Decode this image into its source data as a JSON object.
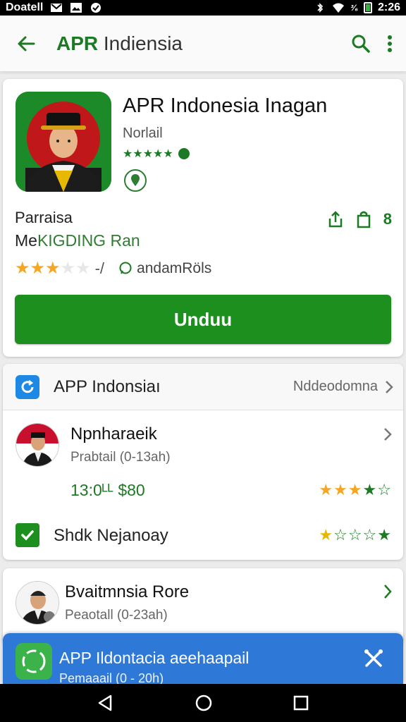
{
  "statusbar": {
    "carrier": "Doatell",
    "network": "³⁄₆",
    "time": "2:26"
  },
  "appbar": {
    "title_brand": "APR",
    "title_rest": "Indiensia"
  },
  "app": {
    "name": "APR Indonesia Inagan",
    "developer": "Norlail",
    "meta_line1": "Parraisa",
    "meta_line2_a": "Me",
    "meta_line2_b": "KIGDING Ran",
    "count_badge": "8",
    "rating_dash": "-/",
    "review_label": "andamRöls",
    "rating_stars": 3,
    "install_label": "Unduu"
  },
  "section": {
    "title": "APP Indonsiaı",
    "more_label": "Nddeodomna",
    "item1": {
      "name": "Npnharaeik",
      "subtitle": "Prabtail (0-13ah)",
      "price": "13:0ᴸᴸ $80"
    },
    "item2": {
      "label": "Shdk Nejanoay"
    }
  },
  "card3": {
    "name": "Bvaitmnsia Rore",
    "subtitle": "Peaotall (0-23ah)"
  },
  "banner": {
    "title": "APP Ildontacia aeehaapail",
    "subtitle": "Pemaaail (0 - 20h)"
  },
  "colors": {
    "brand_green": "#1d8f1f",
    "banner_blue": "#2e79d8",
    "star_gold": "#f5a623"
  }
}
